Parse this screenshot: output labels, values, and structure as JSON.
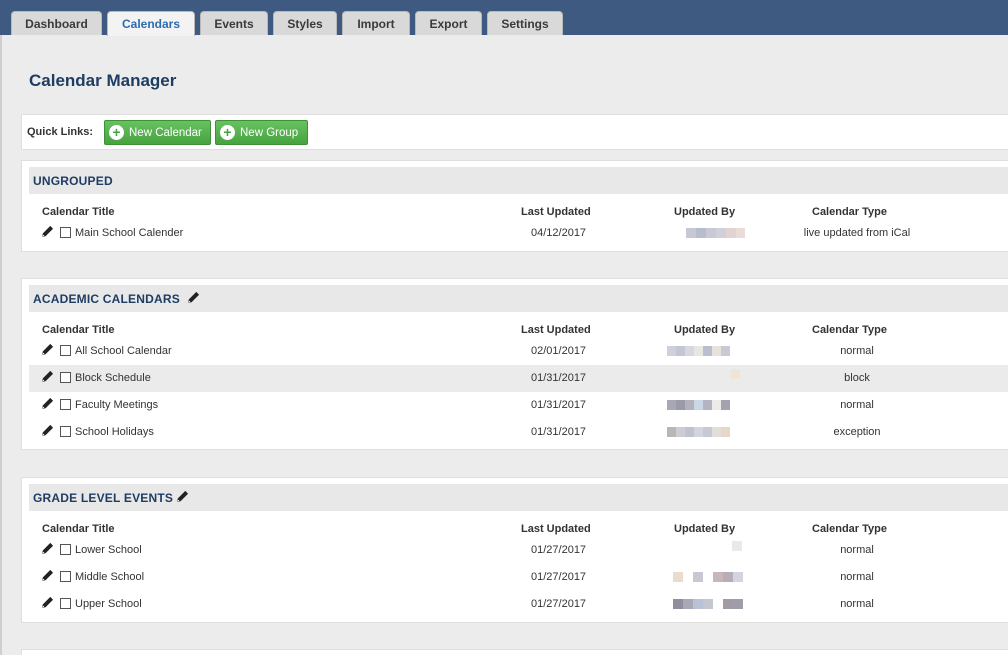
{
  "tabs": [
    "Dashboard",
    "Calendars",
    "Events",
    "Styles",
    "Import",
    "Export",
    "Settings"
  ],
  "active_tab": "Calendars",
  "page": {
    "title": "Calendar Manager"
  },
  "quick_links": {
    "label": "Quick Links:",
    "new_calendar": "New Calendar",
    "new_group": "New Group"
  },
  "columns": {
    "title": "Calendar Title",
    "updated": "Last Updated",
    "by": "Updated By",
    "type": "Calendar Type"
  },
  "groups": [
    {
      "name": "UNGROUPED",
      "editable": false,
      "rows": [
        {
          "title": "Main School Calender",
          "updated": "04/12/2017",
          "type": "live updated from iCal"
        }
      ]
    },
    {
      "name": "ACADEMIC CALENDARS",
      "editable": true,
      "rows": [
        {
          "title": "All School Calendar",
          "updated": "02/01/2017",
          "type": "normal"
        },
        {
          "title": "Block Schedule",
          "updated": "01/31/2017",
          "type": "block"
        },
        {
          "title": "Faculty Meetings",
          "updated": "01/31/2017",
          "type": "normal"
        },
        {
          "title": "School Holidays",
          "updated": "01/31/2017",
          "type": "exception"
        }
      ]
    },
    {
      "name": "GRADE LEVEL EVENTS",
      "editable": true,
      "rows": [
        {
          "title": "Lower School",
          "updated": "01/27/2017",
          "type": "normal"
        },
        {
          "title": "Middle School",
          "updated": "01/27/2017",
          "type": "normal"
        },
        {
          "title": "Upper School",
          "updated": "01/27/2017",
          "type": "normal"
        }
      ]
    }
  ],
  "colors": {
    "topbar": "#3e5a80",
    "accent": "#2d6bb0",
    "heading": "#1e3d63",
    "green_button": "#47a33f"
  },
  "icons": [
    "pencil-icon",
    "plus-circle-icon",
    "checkbox"
  ]
}
